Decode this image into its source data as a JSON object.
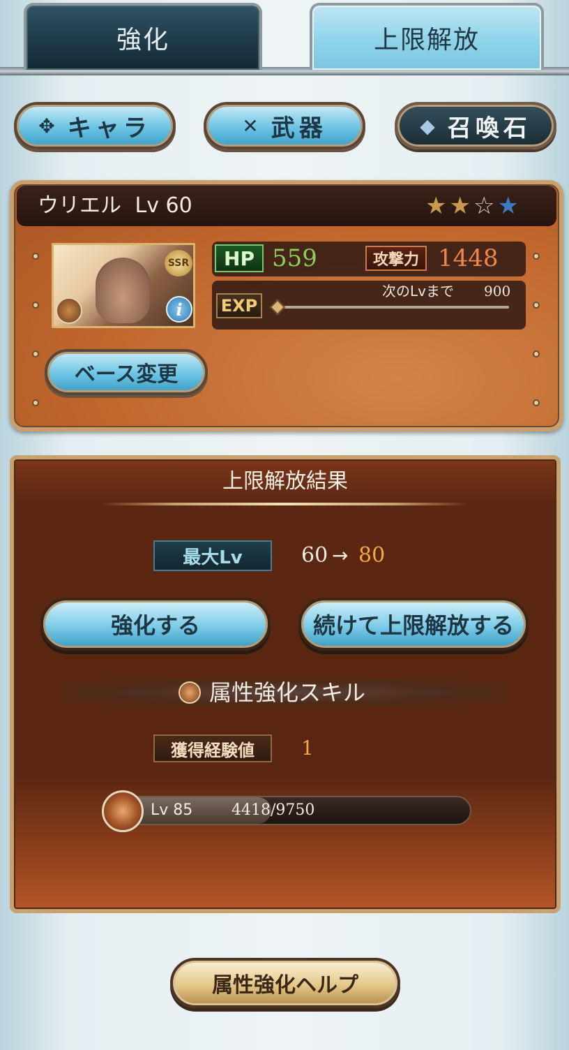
{
  "tabs": [
    {
      "label": "強化",
      "active": false
    },
    {
      "label": "上限解放",
      "active": true
    }
  ],
  "categories": [
    {
      "label": "キャラ",
      "icon": "wings-emblem-icon",
      "selected": false
    },
    {
      "label": "武器",
      "icon": "crossed-weapons-icon",
      "selected": false
    },
    {
      "label": "召喚石",
      "icon": "crystal-icon",
      "selected": true
    }
  ],
  "character": {
    "name": "ウリエル",
    "level_label": "Lv 60",
    "rarity": "SSR",
    "stars": {
      "filled": 2,
      "empty": 1,
      "blue": 1
    },
    "hp_label": "HP",
    "hp": "559",
    "atk_label": "攻撃力",
    "atk": "1448",
    "exp_label": "EXP",
    "next_lv_label": "次のLvまで",
    "next_lv_value": "900",
    "exp_progress": 0.0,
    "base_change_label": "ベース変更"
  },
  "result": {
    "title": "上限解放結果",
    "max_lv_label": "最大Lv",
    "max_lv_from": "60",
    "arrow": "→",
    "max_lv_to": "80",
    "enhance_button": "強化する",
    "continue_button": "続けて上限解放する",
    "skill_title": "属性強化スキル",
    "exp_gained_label": "獲得経験値",
    "exp_gained_value": "1",
    "skill_level": "Lv 85",
    "skill_exp": "4418/9750",
    "skill_progress": 0.4531
  },
  "help_button": "属性強化ヘルプ",
  "colors": {
    "accent_blue": "#6cc4e3",
    "hp_green": "#8ed055",
    "atk_orange": "#f0874a",
    "highlight_orange": "#f3a94a",
    "panel_brown": "#5a2611"
  }
}
